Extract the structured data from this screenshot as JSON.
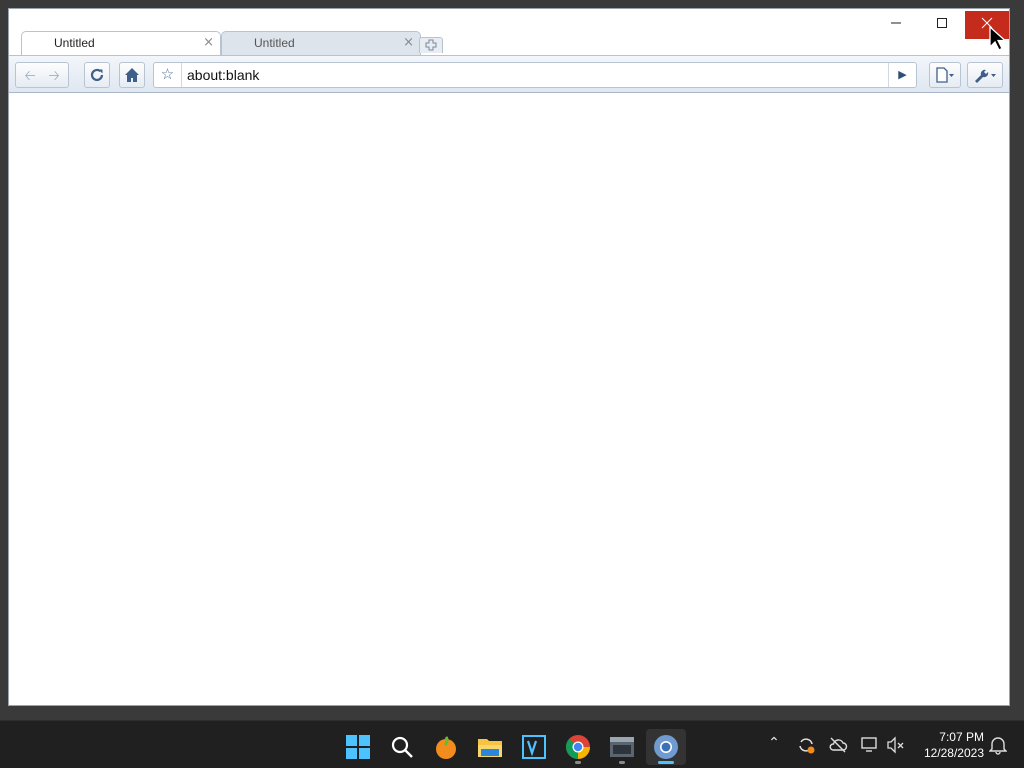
{
  "tabs": [
    {
      "title": "Untitled",
      "active": true
    },
    {
      "title": "Untitled",
      "active": false
    }
  ],
  "tab_close_glyph": "×",
  "omnibox": {
    "url": "about:blank"
  },
  "window_controls": {
    "minimize_icon": "minimize-icon",
    "maximize_icon": "maximize-icon",
    "close_icon": "close-icon"
  },
  "colors": {
    "close_hover": "#c42b1c",
    "taskbar": "#202020",
    "active_indicator": "#4cc2ff"
  },
  "taskbar": {
    "apps": [
      "windows-start-icon",
      "search-icon",
      "fl-studio-icon",
      "file-explorer-icon",
      "visual-studio-icon",
      "chrome-icon",
      "terminal-icon",
      "chromium-icon"
    ],
    "clock": {
      "time": "7:07 PM",
      "date": "12/28/2023"
    }
  }
}
